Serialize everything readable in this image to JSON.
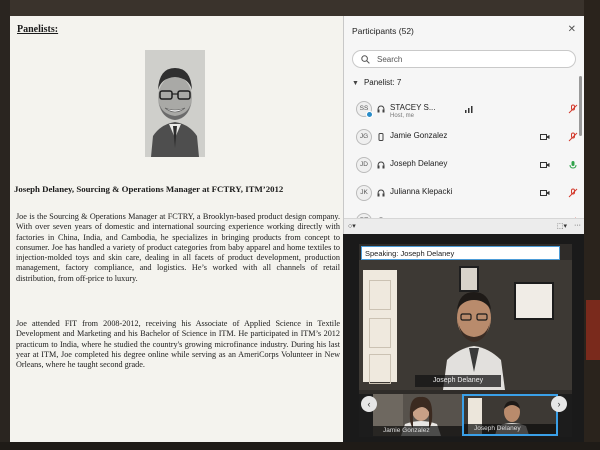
{
  "document": {
    "heading": "Panelists:",
    "title": "Joseph Delaney, Sourcing & Operations Manager at FCTRY, ITM’2012",
    "paragraph1": "Joe is the Sourcing & Operations Manager at FCTRY, a Brooklyn-based product design company. With over seven years of domestic and international sourcing experience working directly with factories in China, India, and Cambodia, he specializes in bringing products from concept to consumer. Joe has handled a variety of product categories from baby apparel and home textiles to injection-molded toys and skin care, dealing in all facets of product development, production management, factory compliance, and logistics. He’s worked with all channels of retail distribution, from off-price to luxury.",
    "paragraph2": "Joe attended FIT from 2008-2012, receiving his Associate of Applied Science in Textile Development and Marketing and his Bachelor of Science in ITM. He participated in ITM’s 2012 practicum to India, where he studied the country's growing microfinance industry. During his last year at ITM, Joe completed his degree online while serving as an AmeriCorps Volunteer in New Orleans, where he taught second grade."
  },
  "participants": {
    "title": "Participants (52)",
    "close_icon": "close-icon",
    "search_placeholder": "Search",
    "group_label": "Panelist: 7",
    "rows": [
      {
        "initials": "SS",
        "name": "STACEY S...",
        "subtitle": "Host, me",
        "device": "headset-icon",
        "audio": "signal-icon",
        "mic": "mic-muted-icon"
      },
      {
        "initials": "JG",
        "name": "Jamie Gonzalez",
        "device": "phone-icon",
        "video": "camera-icon",
        "mic": "mic-muted-icon"
      },
      {
        "initials": "JD",
        "name": "Joseph Delaney",
        "device": "headset-icon",
        "video": "camera-icon",
        "mic": "mic-active-icon"
      },
      {
        "initials": "JK",
        "name": "Julianna Klepacki",
        "device": "headset-icon",
        "video": "camera-icon",
        "mic": "mic-muted-icon"
      },
      {
        "initials": "RT",
        "name": "",
        "device": "headset-icon",
        "mic": "mic-muted-icon"
      }
    ],
    "colors": {
      "accent": "#2a8cc8",
      "muted": "#d33a2c",
      "active": "#2fa34a"
    }
  },
  "video": {
    "speaking_label": "Speaking: Joseph Delaney",
    "main_name": "Joseph Delaney",
    "thumbnails": [
      {
        "name": "Jamie Gonzalez"
      },
      {
        "name": "Joseph Delaney"
      }
    ],
    "active_border": "#3aa0e8"
  }
}
